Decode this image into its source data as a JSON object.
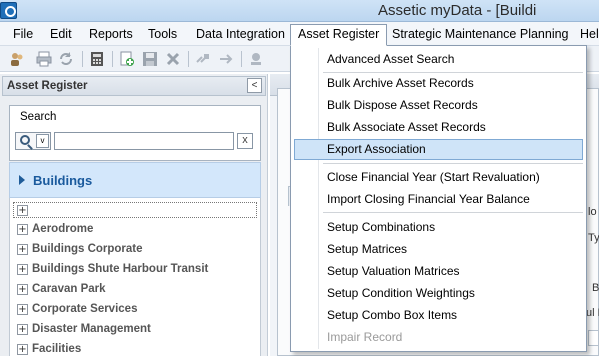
{
  "window": {
    "title": "Assetic myData - [Buildi"
  },
  "menu": [
    {
      "id": "file",
      "label": "File"
    },
    {
      "id": "edit",
      "label": "Edit"
    },
    {
      "id": "reports",
      "label": "Reports"
    },
    {
      "id": "tools",
      "label": "Tools"
    },
    {
      "id": "data-integration",
      "label": "Data Integration"
    },
    {
      "id": "asset-register",
      "label": "Asset Register",
      "active": true
    },
    {
      "id": "strategic-maintenance-planning",
      "label": "Strategic Maintenance Planning"
    },
    {
      "id": "help",
      "label": "Help"
    }
  ],
  "toolbar": {
    "icons": [
      "users-icon",
      "print-icon",
      "refresh-icon",
      "calculator-icon",
      "new-record-icon",
      "save-icon",
      "delete-icon",
      "link-icon",
      "move-icon",
      "stamp-icon"
    ]
  },
  "left_panel": {
    "title": "Asset Register",
    "collapse_glyph": "<",
    "search": {
      "label": "Search",
      "value": "",
      "dropdown_glyph": "v",
      "clear_glyph": "x"
    },
    "selected_category": "Buildings",
    "tree_root_expander": "+",
    "tree_items": [
      {
        "label": "Aerodrome",
        "expander": "+"
      },
      {
        "label": "Buildings Corporate",
        "expander": "+"
      },
      {
        "label": "Buildings Shute Harbour Transit",
        "expander": "+"
      },
      {
        "label": "Caravan Park",
        "expander": "+"
      },
      {
        "label": "Corporate Services",
        "expander": "+"
      },
      {
        "label": "Disaster Management",
        "expander": "+"
      },
      {
        "label": "Facilities",
        "expander": "+"
      }
    ]
  },
  "right_panel_fragments": {
    "frag1": "lo",
    "frag2": "Ty",
    "frag3": "B",
    "frag4": "ul L"
  },
  "asset_register_menu": {
    "items": [
      {
        "id": "advanced-asset-search",
        "label": "Advanced Asset Search"
      },
      {
        "id": "bulk-archive-asset-records",
        "label": "Bulk Archive Asset Records"
      },
      {
        "id": "bulk-dispose-asset-records",
        "label": "Bulk Dispose Asset Records"
      },
      {
        "id": "bulk-associate-asset-records",
        "label": "Bulk Associate Asset Records"
      },
      {
        "id": "export-association",
        "label": "Export Association",
        "highlighted": true
      },
      {
        "id": "close-financial-year",
        "label": "Close Financial Year (Start Revaluation)"
      },
      {
        "id": "import-closing-financial-year-balance",
        "label": "Import Closing Financial Year Balance"
      },
      {
        "id": "setup-combinations",
        "label": "Setup Combinations"
      },
      {
        "id": "setup-matrices",
        "label": "Setup Matrices"
      },
      {
        "id": "setup-valuation-matrices",
        "label": "Setup Valuation Matrices"
      },
      {
        "id": "setup-condition-weightings",
        "label": "Setup Condition Weightings"
      },
      {
        "id": "setup-combo-box-items",
        "label": "Setup Combo Box Items"
      },
      {
        "id": "impair-record",
        "label": "Impair Record",
        "disabled": true
      }
    ]
  }
}
